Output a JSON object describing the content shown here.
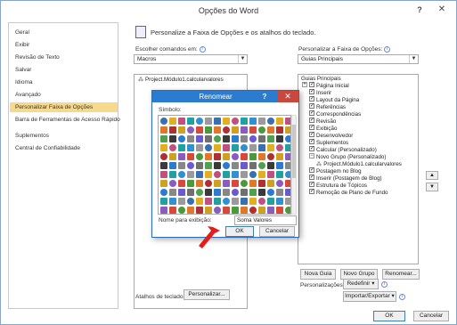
{
  "window": {
    "title": "Opções do Word",
    "help": "?",
    "close": "✕"
  },
  "sidebar": {
    "items": [
      {
        "label": "Geral"
      },
      {
        "label": "Exibir"
      },
      {
        "label": "Revisão de Texto"
      },
      {
        "label": "Salvar"
      },
      {
        "label": "Idioma"
      },
      {
        "label": "Avançado"
      },
      {
        "label": "Personalizar Faixa de Opções"
      },
      {
        "label": "Barra de Ferramentas de Acesso Rápido"
      },
      {
        "label": "Suplementos"
      },
      {
        "label": "Central de Confiabilidade"
      }
    ],
    "active_index": 6
  },
  "header": {
    "text": "Personalize a Faixa de Opções e os atalhos do teclado."
  },
  "left_panel": {
    "commands_label": "Escolher comandos em:",
    "commands_value": "Macros",
    "list_items": [
      "Project.Módulo1.calcularvalores"
    ],
    "keyboard_label": "Atalhos de teclado:",
    "keyboard_button": "Personalizar..."
  },
  "right_panel": {
    "ribbon_label": "Personalizar a Faixa de Opções:",
    "ribbon_value": "Guias Principais",
    "tree_header": "Guias Principais",
    "tree": [
      {
        "label": "Página Inicial",
        "expander": "+",
        "checked": true,
        "indent": 0
      },
      {
        "label": "Inserir",
        "expander": "",
        "checked": true,
        "indent": 0
      },
      {
        "label": "Layout da Página",
        "expander": "",
        "checked": true,
        "indent": 0
      },
      {
        "label": "Referências",
        "expander": "",
        "checked": true,
        "indent": 0
      },
      {
        "label": "Correspondências",
        "expander": "",
        "checked": true,
        "indent": 0
      },
      {
        "label": "Revisão",
        "expander": "",
        "checked": true,
        "indent": 0
      },
      {
        "label": "Exibição",
        "expander": "",
        "checked": true,
        "indent": 0
      },
      {
        "label": "Desenvolvedor",
        "expander": "",
        "checked": true,
        "indent": 0
      },
      {
        "label": "Suplementos",
        "expander": "",
        "checked": true,
        "indent": 0
      },
      {
        "label": "Calcular (Personalizado)",
        "expander": "",
        "checked": true,
        "indent": 0
      },
      {
        "label": "Novo Grupo (Personalizado)",
        "expander": "−",
        "checked": null,
        "indent": 1
      },
      {
        "label": "Project.Módulo1.calcularvalores",
        "expander": "",
        "checked": null,
        "indent": 2
      },
      {
        "label": "Postagem no Blog",
        "expander": "",
        "checked": true,
        "indent": 0
      },
      {
        "label": "Inserir (Postagem de Blog)",
        "expander": "",
        "checked": true,
        "indent": 0
      },
      {
        "label": "Estrutura de Tópicos",
        "expander": "",
        "checked": true,
        "indent": 0
      },
      {
        "label": "Remoção de Plano de Fundo",
        "expander": "",
        "checked": true,
        "indent": 0
      }
    ],
    "new_tab_button": "Nova Guia",
    "new_group_button": "Novo Grupo",
    "rename_button": "Renomear...",
    "custom_label": "Personalizações:",
    "reset_button": "Redefinir ▾",
    "import_export_button": "Importar/Exportar ▾",
    "move_up": "▲",
    "move_down": "▼"
  },
  "footer": {
    "ok": "OK",
    "cancel": "Cancelar"
  },
  "dialog": {
    "title": "Renomear",
    "help": "?",
    "close": "✕",
    "symbols_label": "Símbolo:",
    "display_name_label": "Nome para exibição:",
    "display_name_value": "Soma Valores",
    "ok": "OK",
    "cancel": "Cancelar",
    "symbol_colors": [
      "#3a6fb0",
      "#d9483b",
      "#2b7bd0",
      "#e0b020",
      "#4a9a3a",
      "#888888",
      "#c05080",
      "#e07828",
      "#6a5acd",
      "#20a0a0",
      "#b03030",
      "#707070",
      "#3090d0",
      "#d0a020",
      "#50a050",
      "#9a9a9a",
      "#8a5cc0",
      "#3a3a3a"
    ]
  }
}
